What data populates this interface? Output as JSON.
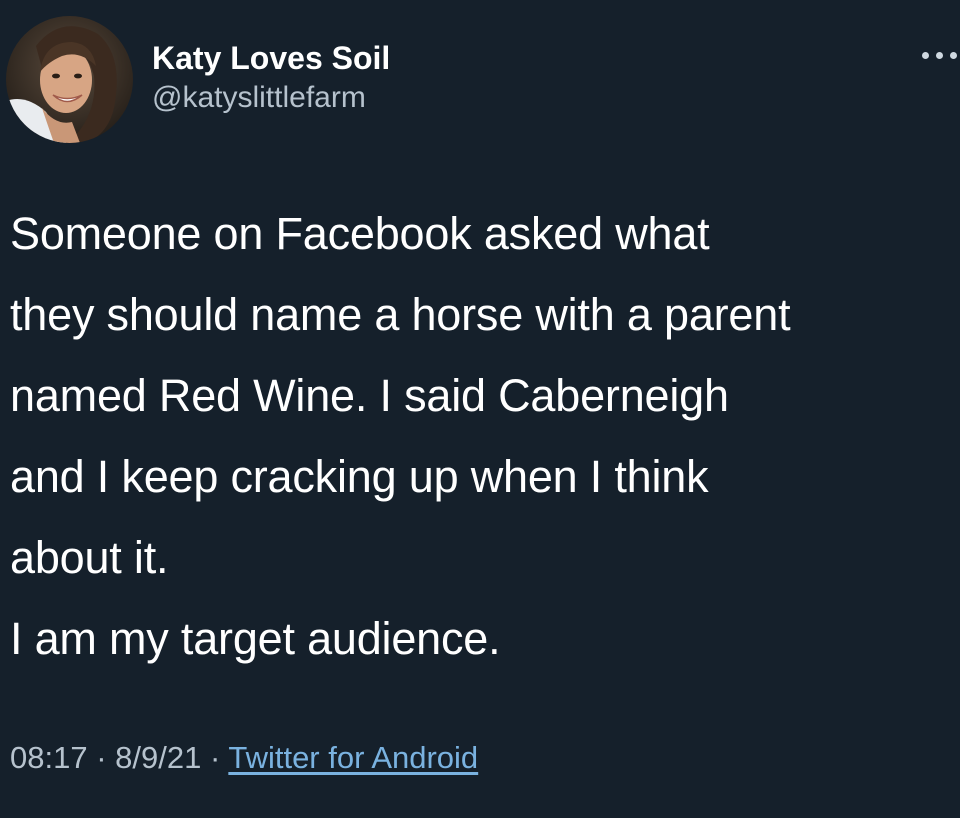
{
  "author": {
    "display_name": "Katy Loves Soil",
    "handle": "@katyslittlefarm",
    "avatar_icon": "profile-photo-avatar"
  },
  "menu": {
    "icon": "more-options-icon"
  },
  "tweet": {
    "lines": [
      "Someone on Facebook asked what",
      "they should name a horse with a parent",
      "named Red Wine. I said Caberneigh",
      "and I keep cracking up when I think",
      "about it.",
      "I am my target audience."
    ]
  },
  "meta": {
    "time": "08:17",
    "separator": " · ",
    "date": "8/9/21",
    "source": "Twitter for Android"
  },
  "colors": {
    "background": "#15202b",
    "text": "#ffffff",
    "secondary_text": "#b6c2cd",
    "link": "#7ab2e0"
  }
}
